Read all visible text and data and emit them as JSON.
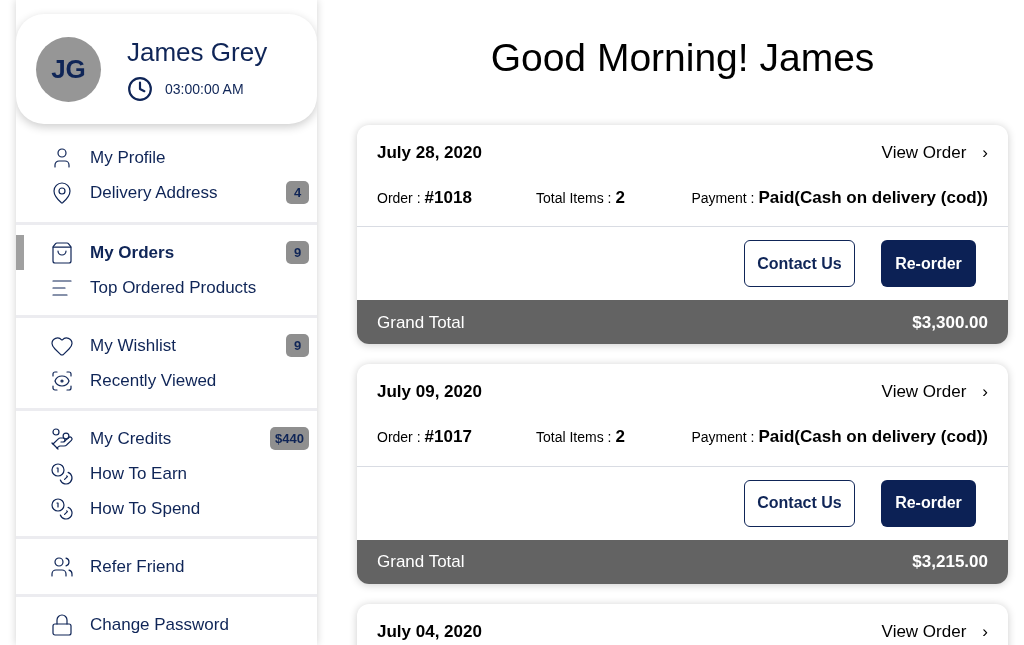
{
  "profile": {
    "initials": "JG",
    "name": "James Grey",
    "time": "03:00:00 AM"
  },
  "sidebar": {
    "groups": [
      {
        "items": [
          {
            "label": "My Profile",
            "selected": false
          },
          {
            "label": "Delivery Address",
            "badge": "4",
            "selected": false
          }
        ]
      },
      {
        "items": [
          {
            "label": "My Orders",
            "badge": "9",
            "selected": true
          },
          {
            "label": "Top Ordered Products",
            "selected": false
          }
        ]
      },
      {
        "items": [
          {
            "label": "My Wishlist",
            "badge": "9",
            "selected": false
          },
          {
            "label": "Recently Viewed",
            "selected": false
          }
        ]
      },
      {
        "items": [
          {
            "label": "My Credits",
            "badge": "$440",
            "selected": false
          },
          {
            "label": "How To Earn",
            "selected": false
          },
          {
            "label": "How To Spend",
            "selected": false
          }
        ]
      },
      {
        "items": [
          {
            "label": "Refer Friend",
            "selected": false
          }
        ]
      },
      {
        "items": [
          {
            "label": "Change Password",
            "selected": false
          }
        ]
      }
    ]
  },
  "greeting": "Good Morning! James",
  "orders": [
    {
      "date": "July 28, 2020",
      "view_link": "View Order",
      "chevron": "›",
      "order_label": "Order :",
      "order_number": "#1018",
      "items_label": "Total Items :",
      "items_count": "2",
      "payment_label": "Payment :",
      "payment_value": "Paid(Cash on delivery (cod))",
      "contact_button": "Contact Us",
      "reorder_button": "Re-order",
      "total_label": "Grand Total",
      "total_value": "$3,300.00"
    },
    {
      "date": "July 09, 2020",
      "view_link": "View Order",
      "chevron": "›",
      "order_label": "Order :",
      "order_number": "#1017",
      "items_label": "Total Items :",
      "items_count": "2",
      "payment_label": "Payment :",
      "payment_value": "Paid(Cash on delivery (cod))",
      "contact_button": "Contact Us",
      "reorder_button": "Re-order",
      "total_label": "Grand Total",
      "total_value": "$3,215.00"
    },
    {
      "date": "July 04, 2020",
      "view_link": "View Order",
      "chevron": "›"
    }
  ]
}
